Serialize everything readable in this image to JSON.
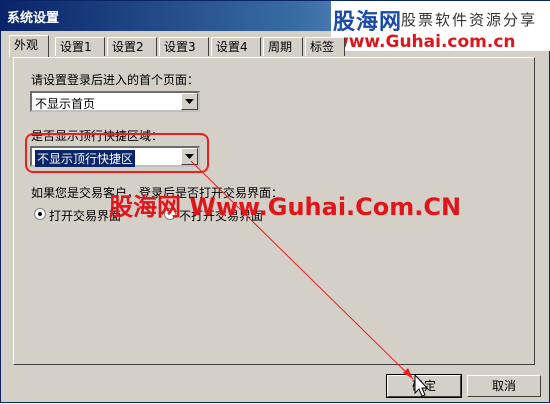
{
  "window": {
    "title": "系统设置"
  },
  "watermark": {
    "logo_cn": "股海网",
    "logo_sub": "股票软件资源分享",
    "logo_url": "www.Guhai.com.cn",
    "center_text": "股海网 Www.Guhai.Com.CN"
  },
  "tabs": [
    {
      "label": "外观"
    },
    {
      "label": "设置1"
    },
    {
      "label": "设置2"
    },
    {
      "label": "设置3"
    },
    {
      "label": "设置4"
    },
    {
      "label": "周期"
    },
    {
      "label": "标签"
    }
  ],
  "settings": {
    "homepage_label": "请设置登录后进入的首个页面：",
    "homepage_value": "不显示首页",
    "toolbar_label": "是否显示顶行快捷区域：",
    "toolbar_value": "不显示顶行快捷区",
    "trade_label": "如果您是交易客户，登录后是否打开交易界面：",
    "trade_options": [
      "打开交易界面",
      "不打开交易界面"
    ]
  },
  "buttons": {
    "ok": "确定",
    "cancel": "取消"
  },
  "colors": {
    "annotation": "#e8201f",
    "titlebar": "#0a246a"
  },
  "icons": [
    "chevron-down-icon",
    "mouse-cursor-icon"
  ]
}
